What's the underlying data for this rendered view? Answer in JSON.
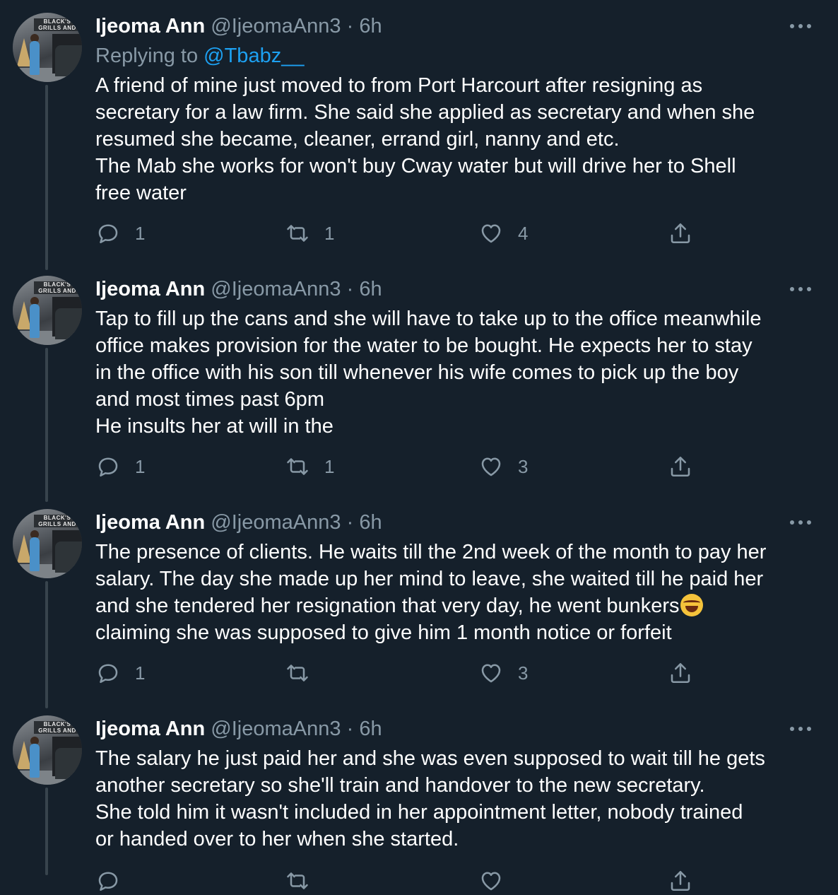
{
  "tweets": [
    {
      "name": "Ijeoma Ann",
      "handle": "@IjeomaAnn3",
      "separator": "·",
      "time": "6h",
      "replying_prefix": "Replying to ",
      "replying_to": "@Tbabz__",
      "lines": [
        "A friend of mine just moved to from Port Harcourt after resigning as",
        "secretary for a law firm. She said she applied as secretary and when she",
        "resumed she became, cleaner, errand girl, nanny and etc.",
        "The Mab she works for won't buy Cway water but will drive her to Shell",
        "free water"
      ],
      "reply_count": "1",
      "retweet_count": "1",
      "like_count": "4"
    },
    {
      "name": "Ijeoma Ann",
      "handle": "@IjeomaAnn3",
      "separator": "·",
      "time": "6h",
      "lines": [
        "Tap to fill up the cans and she will have to take up to the office meanwhile",
        "office makes provision for the water to be bought. He expects her to stay",
        "in the office with his son till whenever his wife comes to pick up the boy",
        "and most times past 6pm",
        "He insults her at will in the"
      ],
      "reply_count": "1",
      "retweet_count": "1",
      "like_count": "3"
    },
    {
      "name": "Ijeoma Ann",
      "handle": "@IjeomaAnn3",
      "separator": "·",
      "time": "6h",
      "lines": [
        "The presence of clients. He waits till the 2nd week of the month to pay her",
        "salary. The day she made up her mind to leave, she waited till he paid her",
        "and she tendered her resignation that very day, he went bunkers",
        "claiming she was supposed to give him 1 month notice or forfeit"
      ],
      "emoji": "rolling-on-floor-laughing-emoji",
      "reply_count": "1",
      "retweet_count": "",
      "like_count": "3"
    },
    {
      "name": "Ijeoma Ann",
      "handle": "@IjeomaAnn3",
      "separator": "·",
      "time": "6h",
      "lines": [
        "The salary he just paid her and she was even supposed to wait till he gets",
        "another secretary so she'll train and handover to the new secretary.",
        "She told him it wasn't included in her appointment letter, nobody trained",
        "or handed over to her when she started."
      ],
      "reply_count": "",
      "retweet_count": "",
      "like_count": ""
    }
  ],
  "avatar_sign": "BLACK'S GRILLS AND",
  "icons": {
    "reply": "speech-bubble-icon",
    "retweet": "retweet-arrows-icon",
    "like": "heart-icon",
    "share": "share-upload-icon",
    "more": "more-dots-icon"
  },
  "colors": {
    "background": "#15202b",
    "primary_text": "#ffffff",
    "secondary_text": "#8899a6",
    "link": "#1da1f2",
    "thread_line": "#38444d"
  }
}
